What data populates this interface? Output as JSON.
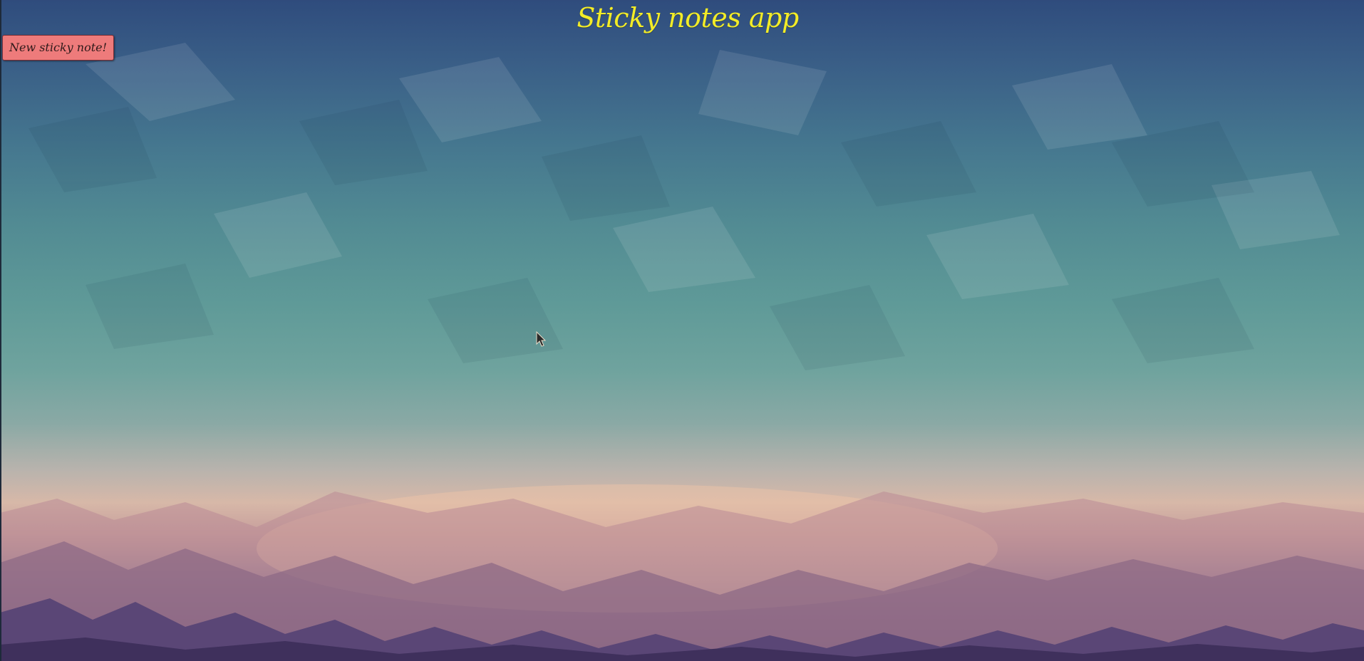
{
  "app": {
    "title": "Sticky notes app"
  },
  "toolbar": {
    "new_note_label": "New sticky note!"
  },
  "colors": {
    "title_text": "#f3ec27",
    "button_background": "#ee7b7b",
    "button_border": "#7a2e35",
    "sky_top": "#2f4c7d",
    "sky_middle": "#5f9a98",
    "horizon": "#d7b8a8",
    "mountains": "#4a3a66"
  },
  "icons": {
    "pointer": "mouse-pointer-icon"
  }
}
